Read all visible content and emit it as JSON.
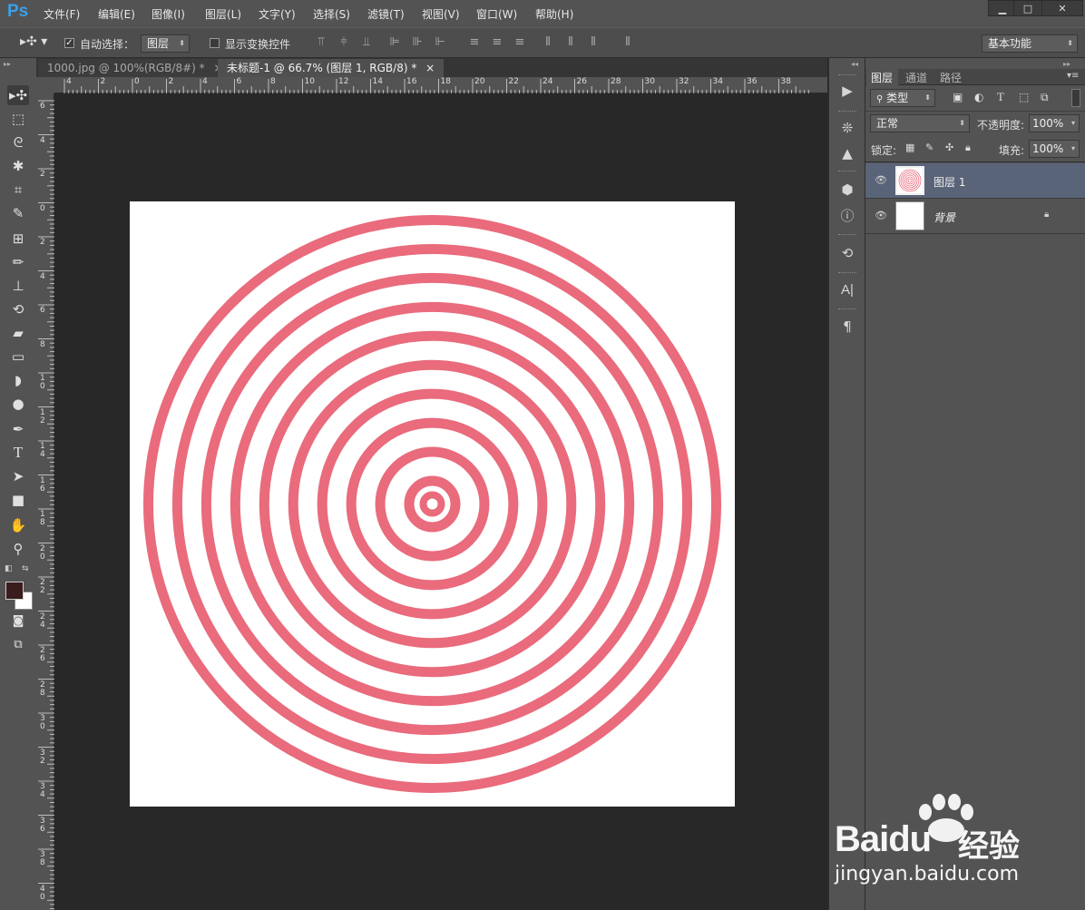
{
  "app": {
    "logo": "Ps"
  },
  "menu": [
    "文件(F)",
    "编辑(E)",
    "图像(I)",
    "图层(L)",
    "文字(Y)",
    "选择(S)",
    "滤镜(T)",
    "视图(V)",
    "窗口(W)",
    "帮助(H)"
  ],
  "window_buttons": [
    "minimize-icon",
    "maximize-icon",
    "close-icon"
  ],
  "options": {
    "auto_select_label": "自动选择：",
    "auto_select_checked": true,
    "auto_select_target": "图层",
    "show_transform_label": "显示变换控件",
    "show_transform_checked": false,
    "workspace": "基本功能"
  },
  "tabs": [
    {
      "label": "1000.jpg @ 100%(RGB/8#) *",
      "close": "×",
      "active": false
    },
    {
      "label": "未标题-1 @ 66.7% (图层 1, RGB/8) *",
      "close": "×",
      "active": true
    }
  ],
  "ruler_top": [
    "4",
    "2",
    "0",
    "2",
    "4",
    "6",
    "8",
    "10",
    "12",
    "14",
    "16",
    "18",
    "20",
    "22",
    "24",
    "26",
    "28",
    "30",
    "32",
    "34",
    "36",
    "38"
  ],
  "ruler_left": [
    "6",
    "4",
    "2",
    "0",
    "2",
    "4",
    "6",
    "8",
    "10",
    "12",
    "14",
    "16",
    "18",
    "20",
    "22",
    "24",
    "26",
    "28",
    "30",
    "32",
    "34",
    "36",
    "38",
    "40"
  ],
  "canvas": {
    "background": "#ffffff",
    "ring_color": "#e96b7c",
    "ring_count": 10,
    "center_dot": true
  },
  "layers_panel": {
    "tabs": [
      "图层",
      "通道",
      "路径"
    ],
    "filter_kind": "类型",
    "blend_mode": "正常",
    "opacity_label": "不透明度:",
    "opacity_value": "100%",
    "lock_label": "锁定:",
    "fill_label": "填充:",
    "fill_value": "100%",
    "layers": [
      {
        "name": "图层 1",
        "selected": true,
        "locked": false
      },
      {
        "name": "背景",
        "selected": false,
        "locked": true
      }
    ]
  },
  "watermark": {
    "brand": "Baidu",
    "brand_cn": "经验",
    "url": "jingyan.baidu.com"
  },
  "colors": {
    "accent": "#3aa0ea",
    "selected_layer": "#5a6478",
    "foreground": "#3a1c1c",
    "background_swatch": "#ffffff"
  }
}
